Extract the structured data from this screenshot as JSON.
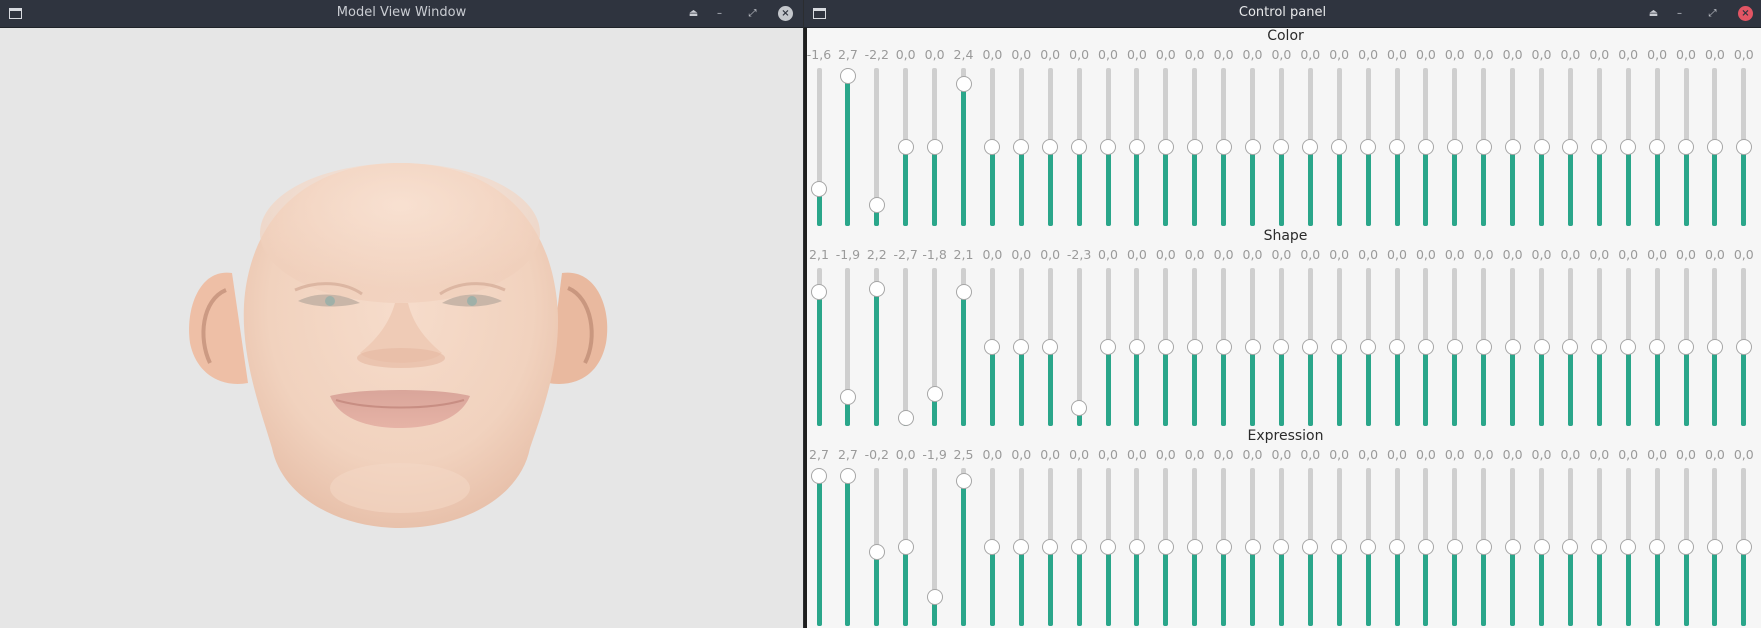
{
  "model_window": {
    "title": "Model View Window",
    "icons": {
      "app": "window-icon",
      "shade": "eject-icon",
      "minimize": "minimize-icon",
      "maximize": "maximize-icon",
      "close": "close-icon"
    },
    "glyphs": {
      "shade": "⏏",
      "minimize": "–",
      "maximize": "⤢",
      "close": "×"
    }
  },
  "control_window": {
    "title": "Control panel",
    "glyphs": {
      "shade": "⏏",
      "minimize": "–",
      "maximize": "⤢",
      "close": "×"
    },
    "colors": {
      "accent": "#2aa68a",
      "track": "#cfcfcf",
      "close": "#e25564"
    },
    "value_range": [
      -3,
      3
    ],
    "sections": [
      {
        "title": "Color",
        "values": [
          "-1,6",
          "2,7",
          "-2,2",
          "0,0",
          "0,0",
          "2,4",
          "0,0",
          "0,0",
          "0,0",
          "0,0",
          "0,0",
          "0,0",
          "0,0",
          "0,0",
          "0,0",
          "0,0",
          "0,0",
          "0,0",
          "0,0",
          "0,0",
          "0,0",
          "0,0",
          "0,0",
          "0,0",
          "0,0",
          "0,0",
          "0,0",
          "0,0",
          "0,0",
          "0,0",
          "0,0",
          "0,0",
          "0,0"
        ]
      },
      {
        "title": "Shape",
        "values": [
          "2,1",
          "-1,9",
          "2,2",
          "-2,7",
          "-1,8",
          "2,1",
          "0,0",
          "0,0",
          "0,0",
          "-2,3",
          "0,0",
          "0,0",
          "0,0",
          "0,0",
          "0,0",
          "0,0",
          "0,0",
          "0,0",
          "0,0",
          "0,0",
          "0,0",
          "0,0",
          "0,0",
          "0,0",
          "0,0",
          "0,0",
          "0,0",
          "0,0",
          "0,0",
          "0,0",
          "0,0",
          "0,0",
          "0,0"
        ]
      },
      {
        "title": "Expression",
        "values": [
          "2,7",
          "2,7",
          "-0,2",
          "0,0",
          "-1,9",
          "2,5",
          "0,0",
          "0,0",
          "0,0",
          "0,0",
          "0,0",
          "0,0",
          "0,0",
          "0,0",
          "0,0",
          "0,0",
          "0,0",
          "0,0",
          "0,0",
          "0,0",
          "0,0",
          "0,0",
          "0,0",
          "0,0",
          "0,0",
          "0,0",
          "0,0",
          "0,0",
          "0,0",
          "0,0",
          "0,0",
          "0,0",
          "0,0"
        ]
      }
    ]
  }
}
